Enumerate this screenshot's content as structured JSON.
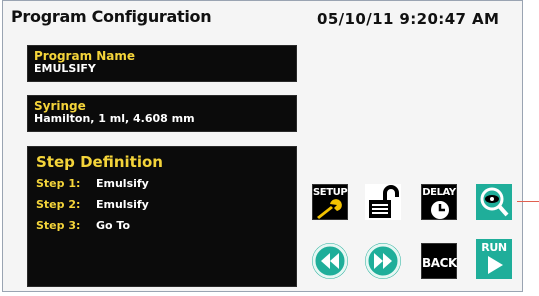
{
  "header": {
    "title": "Program Configuration",
    "datetime": "05/10/11 9:20:47 AM"
  },
  "program_name": {
    "label": "Program Name",
    "value": "EMULSIFY"
  },
  "syringe": {
    "label": "Syringe",
    "value": "Hamilton, 1 ml, 4.608 mm"
  },
  "step_definition": {
    "title": "Step Definition",
    "steps": [
      {
        "number": "Step 1:",
        "action": "Emulsify"
      },
      {
        "number": "Step 2:",
        "action": "Emulsify"
      },
      {
        "number": "Step 3:",
        "action": "Go To"
      }
    ]
  },
  "buttons": {
    "setup": "SETUP",
    "delay": "DELAY",
    "back": "BACK",
    "run": "RUN"
  },
  "icons": {
    "setup": "wrench-icon",
    "lock": "unlock-icon",
    "delay": "clock-icon",
    "view": "eye-magnifier-icon",
    "rewind": "rewind-icon",
    "forward": "fast-forward-icon",
    "run": "play-icon"
  },
  "colors": {
    "label_yellow": "#f4d43a",
    "teal": "#1fae9a",
    "wrench_yellow": "#f2c200"
  }
}
